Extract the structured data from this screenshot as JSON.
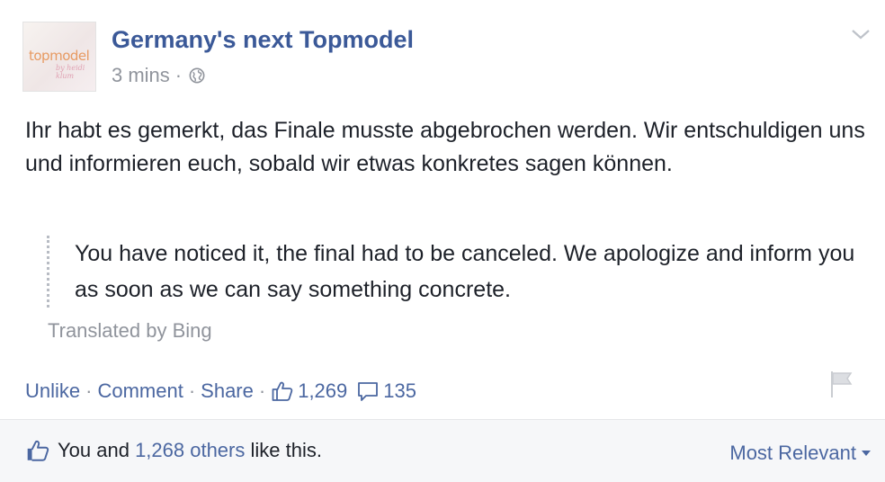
{
  "post": {
    "author": {
      "name": "Germany's next Topmodel",
      "avatar_logo_text": "topmodel",
      "avatar_logo_sub": "by heidi klum"
    },
    "timestamp": "3 mins",
    "separator": "·",
    "privacy_icon": "globe-icon",
    "options_icon": "chevron-down-icon",
    "message": "Ihr habt es gemerkt, das Finale musste abgebrochen werden. Wir entschuldigen uns und informieren euch, sobald wir etwas konkretes sagen können.",
    "translation": {
      "text": "You have noticed it, the final had to be canceled. We apologize and inform you as soon as we can say something concrete.",
      "attribution": "Translated by Bing"
    }
  },
  "actions": {
    "unlike": "Unlike",
    "comment": "Comment",
    "share": "Share",
    "separator": "·",
    "like_count": "1,269",
    "comment_count": "135",
    "like_icon": "thumbs-up-icon",
    "comment_icon": "comment-bubble-icon",
    "flag_icon": "flag-icon"
  },
  "likes_bar": {
    "prefix": "You and ",
    "others_link": "1,268 others",
    "suffix": " like this.",
    "sort_label": "Most Relevant",
    "sort_icon": "caret-down-icon"
  },
  "colors": {
    "link_blue": "#4b67a1",
    "name_blue": "#3b5998",
    "meta_gray": "#90949c",
    "text": "#1d2129",
    "bar_bg": "#f6f7f9"
  }
}
